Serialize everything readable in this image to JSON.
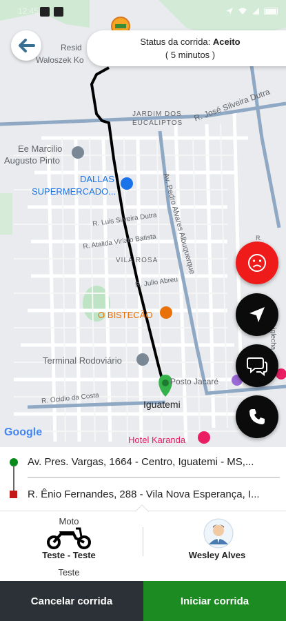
{
  "status_bar": {
    "time": "12:45"
  },
  "header": {
    "status_prefix": "Status da corrida:",
    "status_value": "Aceito",
    "eta": "( 5 minutos )"
  },
  "map": {
    "labels": {
      "street_top": "Resid",
      "street_top2": "Waloszek Ko",
      "jardim": "JARDIM DOS",
      "eucaliptos": "EUCALIPTOS",
      "jose_silveira": "R. José Silveira Dutra",
      "marcilio1": "Ee Marcilio",
      "marcilio2": "Augusto Pinto",
      "dallas1": "DALLAS",
      "dallas2": "SUPERMERCADO...",
      "av_pedro": "Av. Pedro Alvares Albuquerque",
      "luis_silveira": "R. Luis Silveira Dutra",
      "atalida": "R. Atalida Viriato Batista",
      "vila_rosa": "VILA ROSA",
      "abreu": "R. Julio Abreu",
      "bistecao": "O BISTECÃO",
      "terminal": "Terminal Rodoviário",
      "posto": "Posto Jacaré",
      "ocidio": "R. Ocidio da Costa",
      "iguatemi": "Iguatemi",
      "hotel": "Hotel Karanda",
      "google": "Google",
      "r_side": "R.",
      "iglecha": "iglecha"
    }
  },
  "addresses": {
    "origin": "Av. Pres. Vargas, 1664 - Centro, Iguatemi - MS,...",
    "destination": "R. Ênio Fernandes, 288 - Vila Nova Esperança, I..."
  },
  "vehicle": {
    "type": "Moto",
    "model": "Teste - Teste",
    "plate": "Teste"
  },
  "driver": {
    "name": "Wesley Alves"
  },
  "actions": {
    "cancel": "Cancelar corrida",
    "start": "Iniciar corrida"
  },
  "colors": {
    "route": "#000000",
    "origin_dot": "#0a8a1a",
    "destination_dot": "#c21818",
    "cancel_btn": "#2b3136",
    "start_btn": "#1c8c22",
    "emergency_fab": "#ef1b1b"
  },
  "icons": {
    "back": "arrow-left-icon",
    "sad": "sad-face-icon",
    "navigate": "navigation-arrow-icon",
    "chat": "chat-bubble-icon",
    "call": "phone-icon",
    "moto": "motorcycle-icon",
    "avatar": "driver-avatar-icon"
  }
}
